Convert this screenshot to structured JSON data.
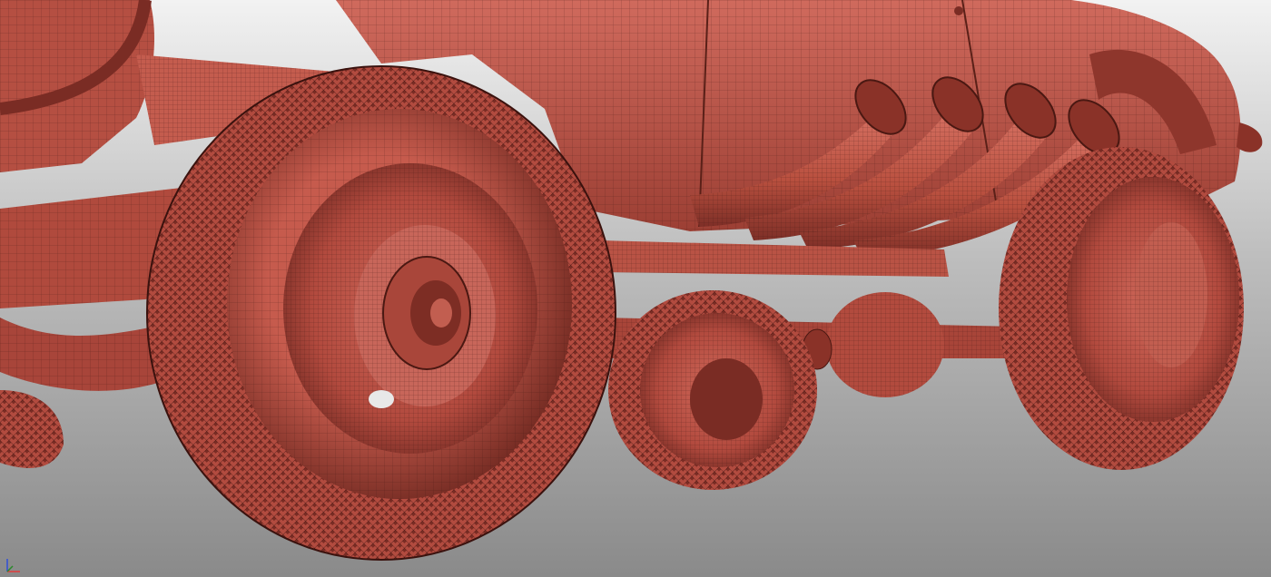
{
  "viewport": {
    "background_top": "#e6e6e6",
    "background_bottom": "#8e8e8e",
    "mesh_color": "#c0574a",
    "mesh_shadow": "#6e2a22",
    "mesh_highlight": "#d9766a",
    "wire_color": "#3a1410"
  },
  "axis_gizmo": {
    "icon": "axis-gizmo-icon",
    "x_color": "#e23b3b",
    "y_color": "#2a8a2a",
    "z_color": "#2f4fd8"
  }
}
